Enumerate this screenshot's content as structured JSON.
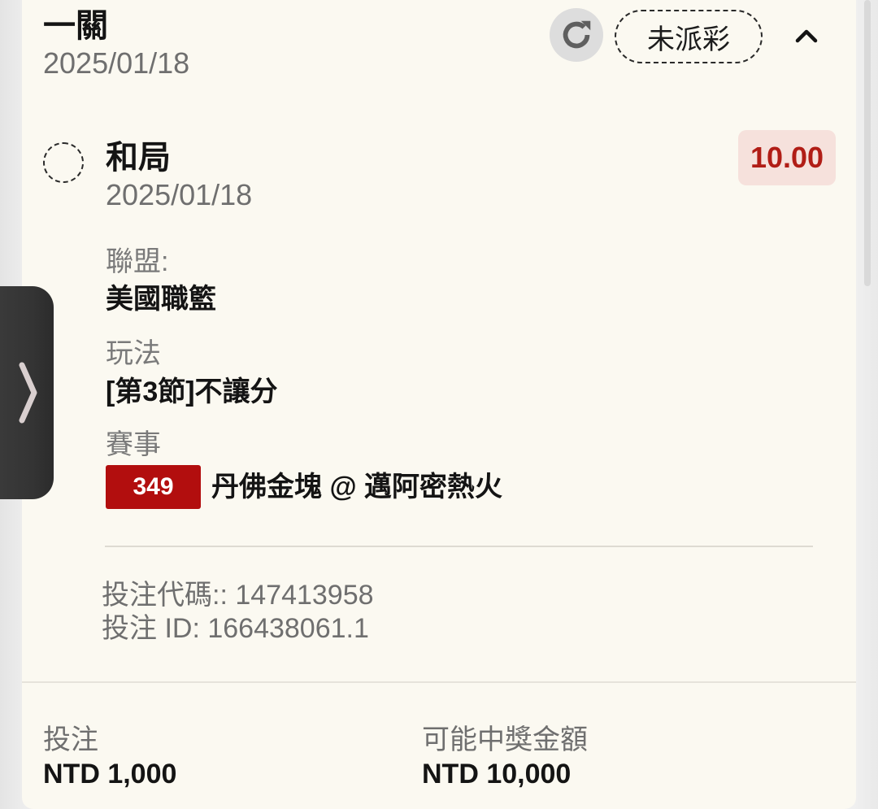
{
  "header": {
    "title": "一關",
    "date": "2025/01/18",
    "status": "未派彩"
  },
  "selection": {
    "name": "和局",
    "date": "2025/01/18",
    "odds": "10.00"
  },
  "details": {
    "league_label": "聯盟:",
    "league_value": "美國職籃",
    "market_label": "玩法",
    "market_value": "[第3節]不讓分",
    "event_label": "賽事",
    "event_number": "349",
    "event_name": "丹佛金塊 @ 邁阿密熱火"
  },
  "meta": {
    "bet_code": "投注代碼:: 147413958",
    "bet_id": "投注 ID: 166438061.1"
  },
  "footer": {
    "stake_label": "投注",
    "stake_value": "NTD 1,000",
    "payout_label": "可能中獎金額",
    "payout_value": "NTD 10,000"
  },
  "colors": {
    "card_bg": "#fbf9f1",
    "odds_text": "#b11d16",
    "odds_bg": "#f6e1dc",
    "event_badge_bg": "#b20e0e"
  },
  "icons": {
    "refresh": "refresh-icon",
    "collapse": "chevron-up-icon",
    "drawer": "chevron-right-icon",
    "selection": "dashed-circle-icon"
  }
}
